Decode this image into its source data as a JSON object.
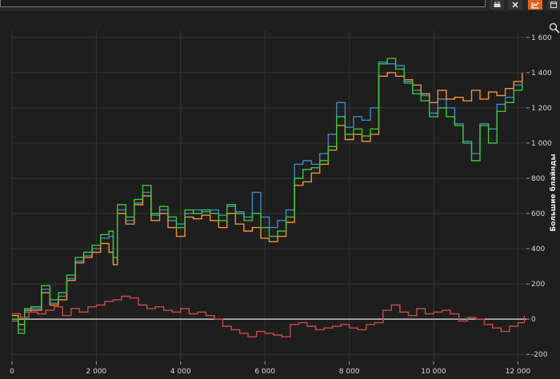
{
  "toolbar": {
    "icons": [
      "print-icon",
      "pin-icon",
      "chart-icon",
      "window-icon"
    ],
    "accent": "#e0641e"
  },
  "chart_data": {
    "type": "line",
    "ylabel": "Большие блайнды",
    "xlim": [
      0,
      12200
    ],
    "ylim": [
      -240,
      1640
    ],
    "x_ticks": [
      0,
      2000,
      4000,
      6000,
      8000,
      10000,
      12000
    ],
    "x_tick_labels": [
      "0",
      "2 000",
      "4 000",
      "6 000",
      "8 000",
      "10 000",
      "12 000"
    ],
    "y_ticks": [
      -200,
      0,
      200,
      400,
      600,
      800,
      1000,
      1200,
      1400,
      1600
    ],
    "y_tick_labels": [
      "-200",
      "0",
      "200",
      "400",
      "600",
      "800",
      "1 000",
      "1 200",
      "1 400",
      "1 600"
    ],
    "grid": true,
    "series": [
      {
        "color": "#3f86c9",
        "x": [
          0,
          150,
          300,
          450,
          700,
          900,
          1100,
          1300,
          1500,
          1700,
          1900,
          2100,
          2300,
          2400,
          2500,
          2700,
          2900,
          3100,
          3300,
          3500,
          3700,
          3900,
          4100,
          4300,
          4500,
          4700,
          4900,
          5100,
          5300,
          5500,
          5700,
          5900,
          6100,
          6300,
          6500,
          6700,
          6900,
          7100,
          7300,
          7500,
          7700,
          7900,
          8100,
          8300,
          8500,
          8700,
          8900,
          9100,
          9300,
          9500,
          9700,
          9900,
          10100,
          10300,
          10500,
          10700,
          10900,
          11100,
          11300,
          11500,
          11700,
          11900,
          12100
        ],
        "y": [
          -10,
          -60,
          40,
          60,
          170,
          90,
          130,
          230,
          330,
          360,
          400,
          460,
          470,
          310,
          620,
          560,
          660,
          720,
          590,
          620,
          560,
          540,
          600,
          620,
          610,
          620,
          590,
          640,
          610,
          580,
          720,
          580,
          520,
          560,
          620,
          880,
          900,
          880,
          940,
          1050,
          1230,
          1090,
          1150,
          1130,
          1200,
          1460,
          1450,
          1440,
          1340,
          1300,
          1270,
          1170,
          1250,
          1200,
          1110,
          1010,
          940,
          1110,
          1080,
          1220,
          1260,
          1330,
          1370
        ]
      },
      {
        "color": "#f0932e",
        "x": [
          0,
          150,
          300,
          450,
          700,
          900,
          1100,
          1300,
          1500,
          1700,
          1900,
          2100,
          2300,
          2400,
          2500,
          2700,
          2900,
          3100,
          3300,
          3500,
          3700,
          3900,
          4100,
          4300,
          4500,
          4700,
          4900,
          5100,
          5300,
          5500,
          5700,
          5900,
          6100,
          6300,
          6500,
          6700,
          6900,
          7100,
          7300,
          7500,
          7700,
          7900,
          8100,
          8300,
          8500,
          8700,
          8900,
          9100,
          9300,
          9500,
          9700,
          9900,
          10100,
          10300,
          10500,
          10700,
          10900,
          11100,
          11300,
          11500,
          11700,
          11900,
          12100
        ],
        "y": [
          20,
          -30,
          50,
          50,
          150,
          80,
          110,
          220,
          320,
          350,
          380,
          430,
          380,
          310,
          600,
          540,
          650,
          700,
          560,
          600,
          520,
          470,
          580,
          570,
          590,
          560,
          520,
          600,
          540,
          500,
          520,
          460,
          440,
          470,
          550,
          760,
          780,
          830,
          880,
          960,
          1100,
          1020,
          1050,
          1010,
          1050,
          1380,
          1400,
          1380,
          1360,
          1330,
          1280,
          1230,
          1300,
          1250,
          1260,
          1240,
          1300,
          1250,
          1290,
          1270,
          1310,
          1350,
          1400
        ]
      },
      {
        "color": "#3ec43a",
        "x": [
          0,
          150,
          300,
          450,
          700,
          900,
          1100,
          1300,
          1500,
          1700,
          1900,
          2100,
          2300,
          2400,
          2500,
          2700,
          2900,
          3100,
          3300,
          3500,
          3700,
          3900,
          4100,
          4300,
          4500,
          4700,
          4900,
          5100,
          5300,
          5500,
          5700,
          5900,
          6100,
          6300,
          6500,
          6700,
          6900,
          7100,
          7300,
          7500,
          7700,
          7900,
          8100,
          8300,
          8500,
          8700,
          8900,
          9100,
          9300,
          9500,
          9700,
          9900,
          10100,
          10300,
          10500,
          10700,
          10900,
          11100,
          11300,
          11500,
          11700,
          11900,
          12100
        ],
        "y": [
          0,
          -80,
          60,
          70,
          190,
          110,
          150,
          250,
          350,
          380,
          420,
          480,
          500,
          350,
          650,
          580,
          680,
          760,
          600,
          640,
          580,
          520,
          620,
          600,
          620,
          600,
          560,
          650,
          600,
          560,
          600,
          520,
          470,
          500,
          580,
          800,
          850,
          860,
          900,
          980,
          1150,
          1050,
          1080,
          1040,
          1080,
          1450,
          1480,
          1420,
          1350,
          1280,
          1240,
          1150,
          1200,
          1150,
          1100,
          1000,
          900,
          1100,
          1000,
          1180,
          1230,
          1300,
          1340
        ]
      },
      {
        "color": "#c74a46",
        "x": [
          0,
          200,
          400,
          600,
          800,
          1000,
          1200,
          1400,
          1600,
          1800,
          2000,
          2200,
          2400,
          2600,
          2800,
          3000,
          3200,
          3400,
          3600,
          3800,
          4000,
          4200,
          4400,
          4600,
          4800,
          5000,
          5200,
          5400,
          5600,
          5800,
          6000,
          6200,
          6400,
          6600,
          6800,
          7000,
          7200,
          7400,
          7600,
          7800,
          8000,
          8200,
          8400,
          8600,
          8800,
          9000,
          9200,
          9400,
          9600,
          9800,
          10000,
          10200,
          10400,
          10600,
          10800,
          11000,
          11200,
          11400,
          11600,
          11800,
          12000,
          12150
        ],
        "y": [
          30,
          10,
          40,
          30,
          50,
          70,
          20,
          60,
          40,
          70,
          80,
          100,
          110,
          130,
          120,
          80,
          60,
          70,
          50,
          40,
          60,
          30,
          40,
          20,
          0,
          -40,
          -60,
          -80,
          -100,
          -70,
          -80,
          -90,
          -100,
          -30,
          -20,
          -40,
          -60,
          -50,
          -40,
          -30,
          -50,
          -60,
          -30,
          -20,
          50,
          80,
          40,
          20,
          60,
          30,
          40,
          50,
          30,
          -10,
          10,
          0,
          -30,
          -50,
          -70,
          -40,
          -20,
          20
        ]
      }
    ]
  }
}
